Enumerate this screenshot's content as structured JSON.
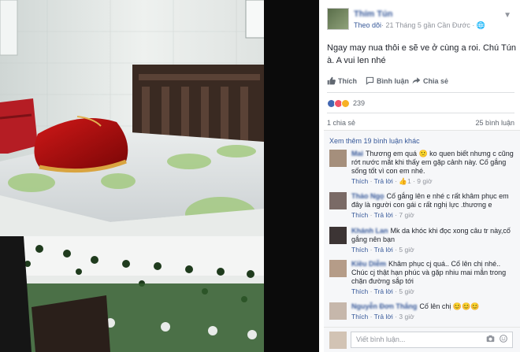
{
  "post": {
    "author": "Thím Tún",
    "follow_label": "Theo dõi",
    "meta": "· 21 Tháng 5 gần Cần Đước · ",
    "text": "Ngay may nua thôi e sẽ ve ở cùng a roi. Chú Tún à. A vui len nhé",
    "actions": {
      "like": "Thích",
      "comment": "Bình luận",
      "share": "Chia sẻ"
    },
    "reaction_count": "239",
    "shares": "1 chia sẻ",
    "comments_count": "25 bình luận",
    "more_comments": "Xem thêm 19 bình luận khác",
    "comments": [
      {
        "name": "Mai",
        "text": "Thương em quá 🙁 ko quen biết nhưng c cũng rớt nước mắt khi thấy em gặp cảnh này. Cố gắng sống tốt vì con em nhé.",
        "like": "Thích",
        "reply": "Trả lời",
        "likes": "1",
        "time": "9 giờ"
      },
      {
        "name": "Thảo Ngọ",
        "text": "Cố gắng lên e nhé c rất khâm phục em đây là người con gái c rất nghị lực .thương e",
        "like": "Thích",
        "reply": "Trả lời",
        "time": "7 giờ"
      },
      {
        "name": "Khánh Lan",
        "text": "Mk da khóc khi đọc xong câu tr này,cố gắng nên bạn",
        "like": "Thích",
        "reply": "Trả lời",
        "time": "5 giờ"
      },
      {
        "name": "Kiều Diễm",
        "text": "Khâm phục cj quá.. Cố lên chị nhé.. Chúc cj thật hạn phúc và gặp nhiu mai mắn trong chặn đường sắp tới",
        "like": "Thích",
        "reply": "Trả lời",
        "time": "5 giờ"
      },
      {
        "name": "Nguyễn Đơn Thắng",
        "text": "Cố lên chị 😊😊😊",
        "like": "Thích",
        "reply": "Trả lời",
        "time": "3 giờ"
      }
    ],
    "write_placeholder": "Viết bình luận..."
  },
  "colors": {
    "link": "#365899",
    "muted": "#90949c",
    "like_blue": "#4267b2",
    "love_red": "#f25268",
    "sad_yellow": "#f7b125"
  }
}
